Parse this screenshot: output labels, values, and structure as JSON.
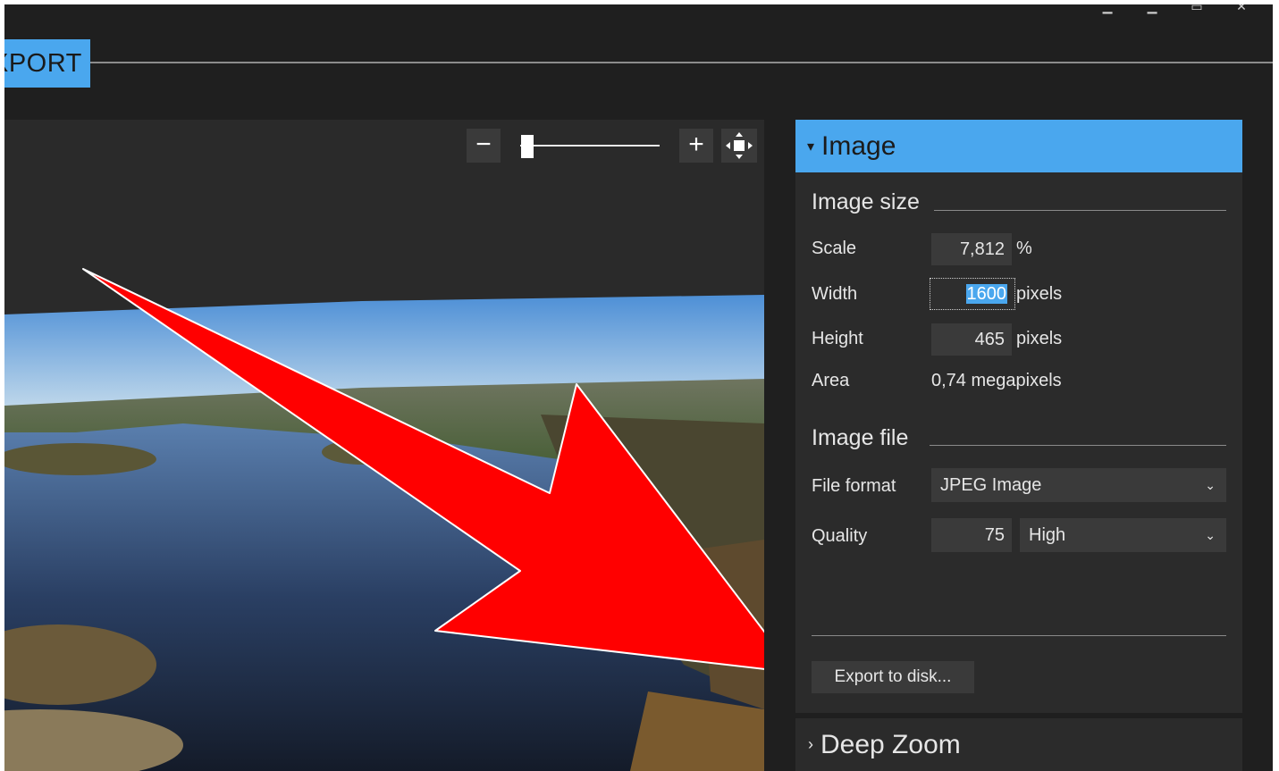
{
  "titlebar": {
    "controls": [
      "minimize-icon",
      "maximize-icon",
      "restore-icon",
      "close-icon"
    ]
  },
  "tab": {
    "label": "XPORT"
  },
  "zoom": {
    "minus": "−",
    "plus": "+",
    "slider_level": 0.05
  },
  "image_panel": {
    "header": "Image",
    "image_size": {
      "title": "Image size",
      "scale_label": "Scale",
      "scale_value": "7,812",
      "scale_unit": "%",
      "width_label": "Width",
      "width_value": "1600",
      "width_unit": "pixels",
      "height_label": "Height",
      "height_value": "465",
      "height_unit": "pixels",
      "area_label": "Area",
      "area_value": "0,74 megapixels"
    },
    "image_file": {
      "title": "Image file",
      "format_label": "File format",
      "format_value": "JPEG Image",
      "quality_label": "Quality",
      "quality_value": "75",
      "quality_level": "High"
    },
    "export_button": "Export to disk..."
  },
  "deep_zoom_panel": {
    "header": "Deep Zoom"
  },
  "colors": {
    "accent": "#4aa7ee",
    "background": "#1f1f1f",
    "panel": "#2b2b2b",
    "arrow": "#ff0000"
  }
}
